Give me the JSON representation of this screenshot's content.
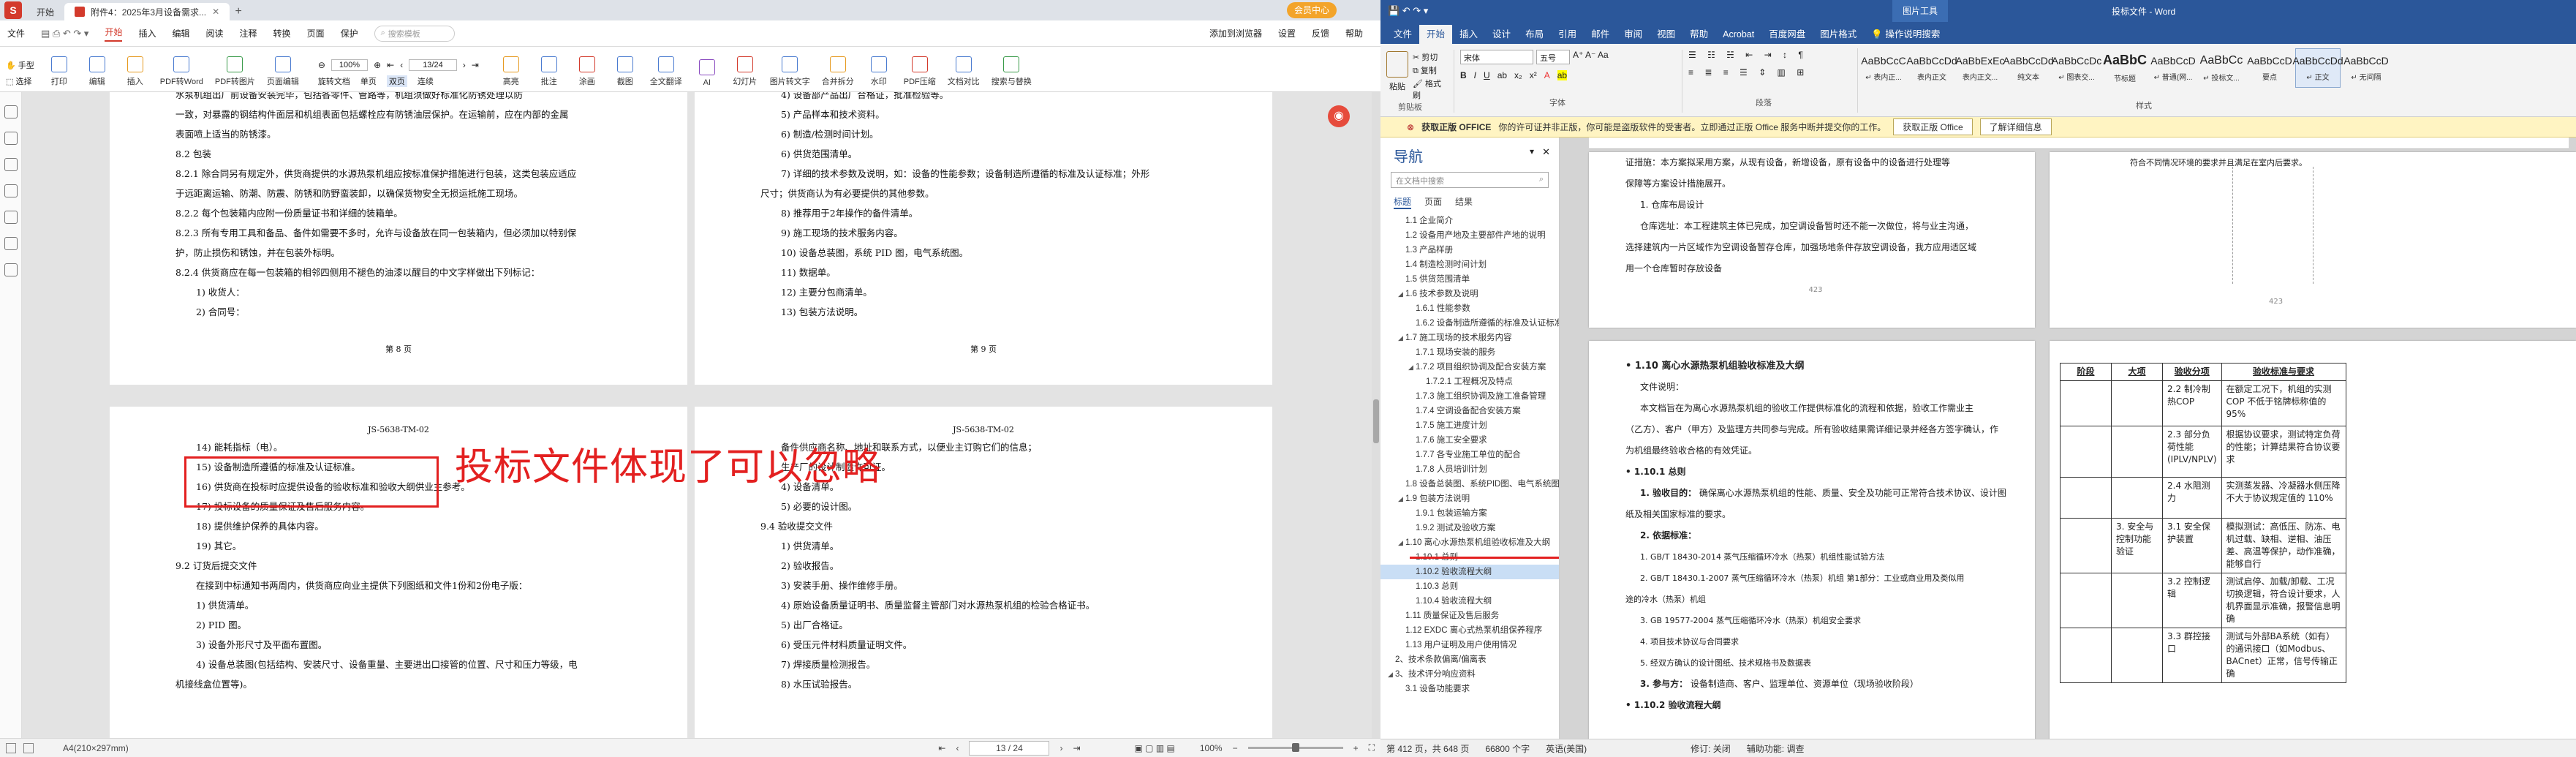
{
  "pdf": {
    "tabs": [
      {
        "label": "开始"
      },
      {
        "label": "附件4：2025年3月设备需求..."
      }
    ],
    "cloud_label": "会员中心",
    "menu": {
      "file": "文件",
      "items": [
        "开始",
        "插入",
        "编辑",
        "阅读",
        "注释",
        "转换",
        "页面",
        "保护"
      ],
      "active": "开始",
      "search_placeholder": "搜索模板",
      "right_items": [
        "添加到浏览器",
        "设置",
        "反馈",
        "帮助"
      ]
    },
    "toolbar": {
      "mode_hand": "手型",
      "mode_select": "选择",
      "buttons": [
        "打印",
        "编辑",
        "插入",
        "PDF转Word",
        "PDF转图片",
        "页面编辑"
      ],
      "zoom": "100%",
      "page_input": "13/24",
      "view_labels": [
        "旋转文档",
        "单页",
        "双页",
        "连续"
      ],
      "right_buttons": [
        "高亮",
        "批注",
        "涂画",
        "截图",
        "全文翻译",
        "AI",
        "幻灯片",
        "图片转文字",
        "合并拆分",
        "水印",
        "PDF压缩",
        "文档对比",
        "搜索与替换"
      ]
    },
    "page8": {
      "lines": [
        "水泵机组出厂前设备安装完毕，包括各零件、管路等，机组须做好标准化防锈处理以防",
        "一致，对暴露的钢结构件面层和机组表面包括螺栓应有防锈油层保护。在运输前，应在内部的金属",
        "表面喷上适当的防锈漆。",
        "8.2 包装",
        "8.2.1 除合同另有规定外，供货商提供的水源热泵机组应按标准保护措施进行包装，这类包装应适应",
        "于远距离运输、防潮、防震、防锈和防野蛮装卸，以确保货物安全无损运抵施工现场。",
        "8.2.2 每个包装箱内应附一份质量证书和详细的装箱单。",
        "8.2.3 所有专用工具和备品、备件如需要不多时，允许与设备放在同一包装箱内，但必须加以特别保",
        "护，防止损伤和锈蚀，并在包装外标明。",
        "8.2.4 供货商应在每一包装箱的相邻四侧用不褪色的油漆以醒目的中文字样做出下列标记：",
        "1) 收货人：",
        "2) 合同号："
      ],
      "footer": "第 8 页"
    },
    "page9": {
      "lines": [
        "4) 设备部产品出厂合格证，批准检验等。",
        "5) 产品样本和技术资料。",
        "6) 制造/检测时间计划。",
        "6) 供货范围清单。",
        "7) 详细的技术参数及说明，如：设备的性能参数；设备制造所遵循的标准及认证标准；外形",
        "尺寸；供货商认为有必要提供的其他参数。",
        "8) 推荐用于2年操作的备件清单。",
        "9) 施工现场的技术服务内容。",
        "10) 设备总装图，系统 PID 图，电气系统图。",
        "11) 数据单。",
        "12) 主要分包商清单。",
        "13) 包装方法说明。"
      ],
      "footer": "第 9 页"
    },
    "page10": {
      "header": "JS-5638-TM-02",
      "lines": [
        "14) 能耗指标（电）。",
        "15) 设备制造所遵循的标准及认证标准。",
        "16) 供货商在投标时应提供设备的验收标准和验收大纲供业主参考。",
        "17) 投标设备的质量保证及售后服务内容。",
        "18) 提供维护保养的具体内容。",
        "19) 其它。",
        "9.2 订货后提交文件",
        "在接到中标通知书两周内，供货商应向业主提供下列图纸和文件1份和2份电子版：",
        "1) 供货清单。",
        "2) PID 图。",
        "3) 设备外形尺寸及平面布置图。",
        "4) 设备总装图(包括结构、安装尺寸、设备重量、主要进出口接管的位置、尺寸和压力等级，电",
        "机接线盒位置等)。"
      ]
    },
    "page11": {
      "header": "JS-5638-TM-02",
      "lines": [
        "备件供应商名称、地址和联系方式，以便业主订购它们的信息；",
        "生产厂的设计制造许可证。",
        "4) 设备清单。",
        "5) 必要的设计图。",
        "9.4 验收提交文件",
        "1) 供货清单。",
        "2) 验收报告。",
        "3) 安装手册、操作维修手册。",
        "4) 原始设备质量证明书、质量监督主管部门对水源热泵机组的检验合格证书。",
        "5) 出厂合格证。",
        "6) 受压元件材料质量证明文件。",
        "7) 焊接质量检测报告。",
        "8) 水压试验报告。"
      ]
    },
    "annotation": "投标文件体现了可以忽略",
    "status": {
      "paper": "A4(210×297mm)",
      "page": "13 / 24",
      "zoom": "100%"
    }
  },
  "word": {
    "title": "投标文件 - Word",
    "context_tab": "图片工具",
    "tabs": [
      "文件",
      "开始",
      "插入",
      "设计",
      "布局",
      "引用",
      "邮件",
      "审阅",
      "视图",
      "帮助",
      "Acrobat",
      "百度网盘",
      "图片格式"
    ],
    "active_tab": "开始",
    "tell_me": "操作说明搜索",
    "clipboard": {
      "paste": "粘贴",
      "cut": "剪切",
      "copy": "复制",
      "painter": "格式刷",
      "group": "剪贴板"
    },
    "font": {
      "name": "宋体",
      "size": "五号",
      "group": "字体"
    },
    "paragraph_group": "段落",
    "styles_group": "样式",
    "styles": [
      {
        "preview": "AaBbCcC",
        "name": "↵ 表内正..."
      },
      {
        "preview": "AaBbCcDd",
        "name": "表内正文"
      },
      {
        "preview": "AaBbExEc",
        "name": "表内正文..."
      },
      {
        "preview": "AaBbCcDd",
        "name": "纯文本"
      },
      {
        "preview": "AaBbCcDc",
        "name": "↵ 图表交..."
      },
      {
        "preview": "AaBbC",
        "name": "节标题"
      },
      {
        "preview": "AaBbCcD",
        "name": "↵ 普通(网..."
      },
      {
        "preview": "AaBbCc",
        "name": "↵ 投标文..."
      },
      {
        "preview": "AaBbCcD",
        "name": "要点"
      },
      {
        "preview": "AaBbCcDd",
        "name": "↵ 正文"
      },
      {
        "preview": "AaBbCcD",
        "name": "↵ 无间隔"
      }
    ],
    "info_bar": {
      "label": "获取正版 OFFICE",
      "message": "你的许可证并非正版，你可能是盗版软件的受害者。立即通过正版 Office 服务中断并提交你的工作。",
      "button1": "获取正版 Office",
      "button2": "了解详细信息"
    },
    "nav": {
      "title": "导航",
      "search_placeholder": "在文档中搜索",
      "tabs": [
        "标题",
        "页面",
        "结果"
      ],
      "items": [
        {
          "level": 2,
          "label": "1.1 企业简介"
        },
        {
          "level": 2,
          "label": "1.2 设备用产地及主要部件产地的说明"
        },
        {
          "level": 2,
          "label": "1.3 产品样册"
        },
        {
          "level": 2,
          "label": "1.4 制造检测时间计划"
        },
        {
          "level": 2,
          "label": "1.5 供货范围清单"
        },
        {
          "level": 2,
          "label": "1.6 技术参数及说明",
          "expand": true
        },
        {
          "level": 3,
          "label": "1.6.1 性能参数"
        },
        {
          "level": 3,
          "label": "1.6.2 设备制造所遵循的标准及认证标准"
        },
        {
          "level": 2,
          "label": "1.7 施工现场的技术服务内容",
          "expand": true
        },
        {
          "level": 3,
          "label": "1.7.1 现场安装的服务"
        },
        {
          "level": 3,
          "label": "1.7.2 项目组织协调及配合安装方案",
          "expand": true
        },
        {
          "level": 4,
          "label": "1.7.2.1 工程概况及特点"
        },
        {
          "level": 3,
          "label": "1.7.3 施工组织协调及施工准备管理"
        },
        {
          "level": 3,
          "label": "1.7.4 空调设备配合安装方案"
        },
        {
          "level": 3,
          "label": "1.7.5 施工进度计划"
        },
        {
          "level": 3,
          "label": "1.7.6 施工安全要求"
        },
        {
          "level": 3,
          "label": "1.7.7 各专业施工单位的配合"
        },
        {
          "level": 3,
          "label": "1.7.8 人员培训计划"
        },
        {
          "level": 2,
          "label": "1.8 设备总装图、系统PID图、电气系统图"
        },
        {
          "level": 2,
          "label": "1.9 包装方法说明",
          "expand": true
        },
        {
          "level": 3,
          "label": "1.9.1 包装运输方案"
        },
        {
          "level": 3,
          "label": "1.9.2 测试及验收方案"
        },
        {
          "level": 2,
          "label": "1.10 离心水源热泵机组验收标准及大纲",
          "expand": true
        },
        {
          "level": 3,
          "label": "1.10.1 总则"
        },
        {
          "level": 3,
          "label": "1.10.2 验收流程大纲",
          "selected": true
        },
        {
          "level": 3,
          "label": "1.10.3 总则"
        },
        {
          "level": 3,
          "label": "1.10.4 验收流程大纲"
        },
        {
          "level": 2,
          "label": "1.11 质量保证及售后服务"
        },
        {
          "level": 2,
          "label": "1.12 EXDC 离心式热泵机组保养程序"
        },
        {
          "level": 2,
          "label": "1.13 用户证明及用户使用情况"
        },
        {
          "level": 1,
          "label": "2、技术条款偏离/偏离表"
        },
        {
          "level": 1,
          "label": "3、技术评分响应资料",
          "expand": true
        },
        {
          "level": 2,
          "label": "3.1 设备功能要求"
        }
      ]
    },
    "page_a": {
      "lines": [
        "证措施：本方案拟采用方案，从现有设备，新增设备，原有设备中的设备进行处理等",
        "保障等方案设计措施展开。",
        "1. 仓库布局设计",
        "仓库选址：本工程建筑主体已完成，加空调设备暂时还不能一次做位，将与业主沟通，",
        "选择建筑内一片区域作为空调设备暂存仓库，加强场地条件存放空调设备，我方应用适区域",
        "用一个仓库暂时存放设备"
      ],
      "footer": "423"
    },
    "page_b": {
      "top_line": "符合不同情况环境的要求并且满足在室内后要求。",
      "footer": "423"
    },
    "page_c": {
      "heading": "1.10  离心水源热泵机组验收标准及大纲",
      "sub": "文件说明：",
      "lines": [
        "本文档旨在为离心水源热泵机组的验收工作提供标准化的流程和依据，验收工作需业主",
        "（乙方）、客户（甲方）及监理方共同参与完成。所有验收结果需详细记录并经各方签字确认，作",
        "为机组最终验收合格的有效凭证。"
      ],
      "h2": "1.10.1 总则",
      "item1_label": "1. 验收目的：",
      "item1": "确保离心水源热泵机组的性能、质量、安全及功能可正常符合技术协议、设计图",
      "item1b": "纸及相关国家标准的要求。",
      "item2_label": "2. 依据标准：",
      "stds": [
        "1. GB/T 18430-2014 蒸气压缩循环冷水（热泵）机组性能试验方法",
        "2. GB/T 18430.1-2007 蒸气压缩循环冷水（热泵）机组 第1部分：工业或商业用及类似用",
        "途的冷水（热泵）机组",
        "3. GB 19577-2004 蒸气压缩循环冷水（热泵）机组安全要求",
        "4. 项目技术协议与合同要求",
        "5. 经双方确认的设计图纸、技术规格书及数据表"
      ],
      "item3_label": "3. 参与方：",
      "item3": "设备制造商、客户、监理单位、资源单位（现场验收阶段）",
      "h2b": "1.10.2 验收流程大纲"
    },
    "table": {
      "headers": [
        "阶段",
        "大项",
        "验收分项",
        "验收标准与要求"
      ],
      "rows": [
        {
          "phase": "",
          "cat": "",
          "sub": "2.2 制冷制热COP",
          "req": "在额定工况下，机组的实测 COP 不低于铭牌标称值的 95%"
        },
        {
          "phase": "",
          "cat": "",
          "sub": "2.3 部分负荷性能(IPLV/NPLV)",
          "req": "根据协议要求，测试特定负荷的性能；计算结果符合协议要求"
        },
        {
          "phase": "",
          "cat": "",
          "sub": "2.4 水阻测力",
          "req": "实测蒸发器、冷凝器水侧压降不大于协议规定值的 110%"
        },
        {
          "phase": "",
          "cat": "3. 安全与控制功能验证",
          "sub": "3.1 安全保护装置",
          "req": "模拟测试：高低压、防冻、电机过载、缺相、逆相、油压差、高温等保护，动作准确，能够自行"
        },
        {
          "phase": "",
          "cat": "",
          "sub": "3.2 控制逻辑",
          "req": "测试启停、加载/卸载、工况切换逻辑，符合设计要求，人机界面显示准确，报警信息明确"
        },
        {
          "phase": "",
          "cat": "",
          "sub": "3.3 群控接口",
          "req": "测试与外部BA系统（如有）的通讯接口（如Modbus、BACnet）正常，信号传输正确"
        }
      ]
    },
    "status": {
      "page": "第 412 页，共 648 页",
      "words": "66800 个字",
      "lang": "英语(美国)",
      "track": "修订: 关闭",
      "access": "辅助功能: 调查"
    }
  }
}
